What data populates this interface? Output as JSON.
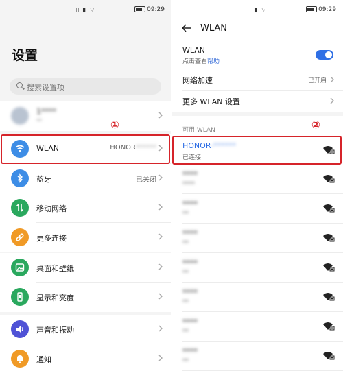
{
  "status_bar": {
    "time": "09:29"
  },
  "left": {
    "title": "设置",
    "search_placeholder": "搜索设置项",
    "account": {
      "name": "1****",
      "sub": "**"
    },
    "items": [
      {
        "label": "WLAN",
        "value": "HONOR",
        "icon": "wifi-icon",
        "color": "#3d8de6"
      },
      {
        "label": "蓝牙",
        "value": "已关闭",
        "icon": "bluetooth-icon",
        "color": "#3d8de6"
      },
      {
        "label": "移动网络",
        "value": "",
        "icon": "mobile-network-icon",
        "color": "#2aa85e"
      },
      {
        "label": "更多连接",
        "value": "",
        "icon": "link-icon",
        "color": "#f09a26"
      },
      {
        "label": "桌面和壁纸",
        "value": "",
        "icon": "wallpaper-icon",
        "color": "#2aa85e"
      },
      {
        "label": "显示和亮度",
        "value": "",
        "icon": "display-icon",
        "color": "#2aa85e"
      },
      {
        "label": "声音和振动",
        "value": "",
        "icon": "sound-icon",
        "color": "#4f52d6"
      },
      {
        "label": "通知",
        "value": "",
        "icon": "bell-icon",
        "color": "#f09a26"
      }
    ],
    "marker": "①"
  },
  "right": {
    "title": "WLAN",
    "wlan": {
      "label": "WLAN",
      "sub_prefix": "点击查看",
      "help": "帮助"
    },
    "accel": {
      "label": "网络加速",
      "value": "已开启"
    },
    "more": {
      "label": "更多 WLAN 设置"
    },
    "available_label": "可用 WLAN",
    "connected": {
      "name": "HONOR",
      "state": "已连接"
    },
    "networks": [
      {
        "name": "****",
        "state": "****"
      },
      {
        "name": "****",
        "state": "**"
      },
      {
        "name": "****",
        "state": "**"
      },
      {
        "name": "****",
        "state": "**"
      },
      {
        "name": "****",
        "state": "**"
      },
      {
        "name": "****",
        "state": "**"
      },
      {
        "name": "****",
        "state": "**"
      }
    ],
    "marker": "②"
  },
  "colors": {
    "accent": "#2f6fe5",
    "highlight": "#d6242a"
  }
}
